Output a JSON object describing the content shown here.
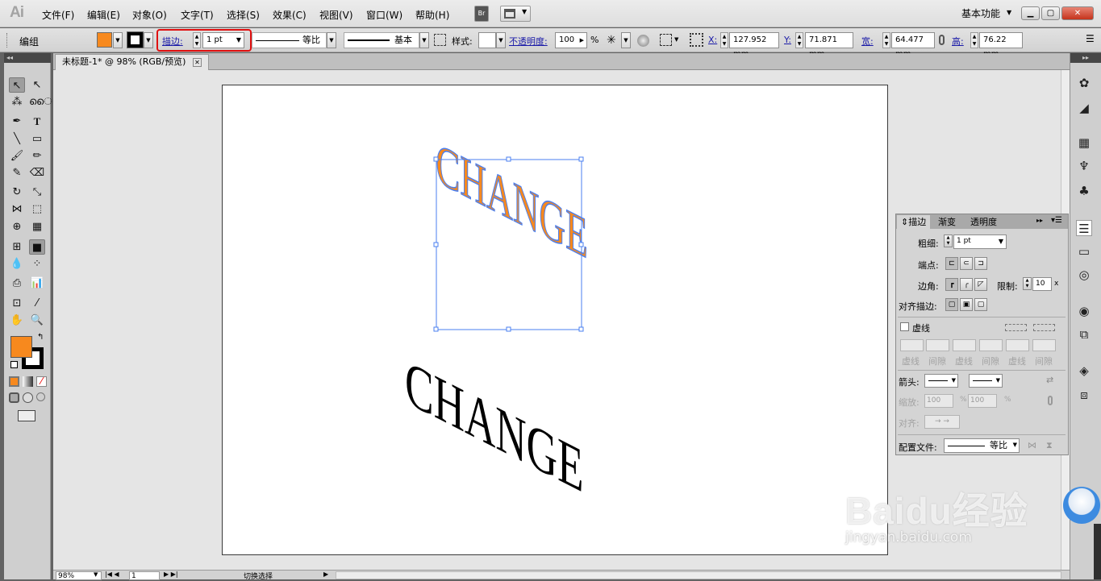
{
  "app": {
    "logo": "Ai"
  },
  "menu": [
    "文件(F)",
    "编辑(E)",
    "对象(O)",
    "文字(T)",
    "选择(S)",
    "效果(C)",
    "视图(V)",
    "窗口(W)",
    "帮助(H)"
  ],
  "menu_buttons": {
    "bridge": "Br"
  },
  "workspace": {
    "label": "基本功能"
  },
  "control": {
    "group_label": "编组",
    "stroke_label": "描边:",
    "stroke_weight": "1 pt",
    "profile": "等比",
    "brush": "基本",
    "style_label": "样式:",
    "opacity_label": "不透明度:",
    "opacity_value": "100",
    "percent": "%",
    "x_label": "X:",
    "x_value": "127.952 mm",
    "y_label": "Y:",
    "y_value": "71.871 mm",
    "w_label": "宽:",
    "w_value": "64.477 mm",
    "h_label": "高:",
    "h_value": "76.22 mm"
  },
  "document": {
    "tab_title": "未标题-1* @ 98% (RGB/预览)",
    "art_text_front": "CHANGE",
    "art_text_back": "CHANGE"
  },
  "status": {
    "zoom": "98%",
    "page": "1",
    "mode": "切换选择"
  },
  "stroke_panel": {
    "tabs": [
      "描边",
      "渐变",
      "透明度"
    ],
    "weight_label": "粗细:",
    "weight_value": "1 pt",
    "cap_label": "端点:",
    "corner_label": "边角:",
    "limit_label": "限制:",
    "limit_value": "10",
    "limit_unit": "x",
    "align_label": "对齐描边:",
    "dashed_label": "虚线",
    "dash_labels": [
      "虚线",
      "间隙",
      "虚线",
      "间隙",
      "虚线",
      "间隙"
    ],
    "arrow_label": "箭头:",
    "scale_label": "缩放:",
    "scale_1": "100",
    "scale_2": "100",
    "percent": "%",
    "align2_label": "对齐:",
    "profile_label": "配置文件:",
    "profile_value": "等比"
  },
  "watermark": {
    "brand": "Baidu经验",
    "url": "jingyan.baidu.com"
  },
  "colors": {
    "fill": "#f7891e",
    "stroke": "#000000",
    "selection": "#4a7ff0",
    "highlight": "#e01010"
  }
}
